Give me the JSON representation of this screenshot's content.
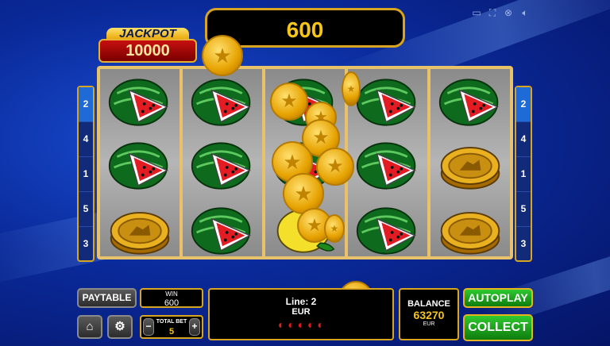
{
  "win_display": "600",
  "jackpot": {
    "label": "JACKPOT",
    "value": "10000"
  },
  "left_lines": [
    "2",
    "4",
    "1",
    "5",
    "3"
  ],
  "right_lines": [
    "2",
    "4",
    "1",
    "5",
    "3"
  ],
  "bottom": {
    "paytable_label": "PAYTABLE",
    "win_label": "WIN",
    "win_value": "600",
    "total_bet_label": "TOTAL BET",
    "total_bet_value": "5",
    "minus": "−",
    "plus": "+",
    "line_text": "Line: 2",
    "line_currency": "EUR",
    "balance_label": "BALANCE",
    "balance_value": "63270",
    "balance_currency": "EUR",
    "autoplay_label": "AUTOPLAY",
    "collect_label": "COLLECT"
  },
  "reels": [
    [
      "watermelon",
      "watermelon",
      "coin"
    ],
    [
      "watermelon",
      "watermelon",
      "watermelon"
    ],
    [
      "watermelon",
      "watermelon",
      "lemon"
    ],
    [
      "watermelon",
      "watermelon",
      "watermelon"
    ],
    [
      "watermelon",
      "coin",
      "coin"
    ]
  ],
  "top_icons": [
    "screen-icon",
    "fullscreen-icon",
    "turbo-icon",
    "sound-icon"
  ]
}
